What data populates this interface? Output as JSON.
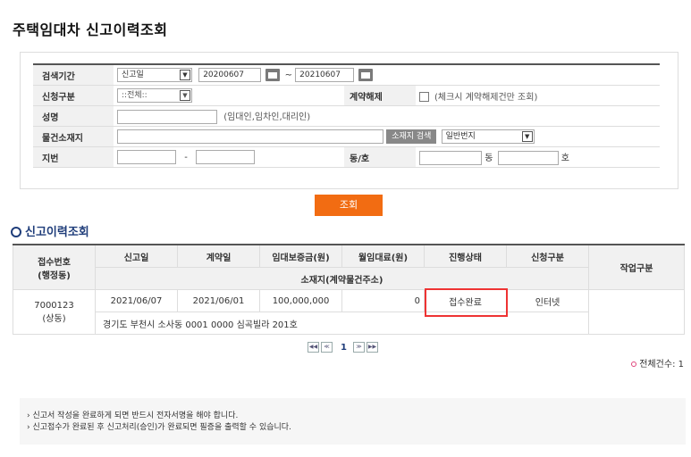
{
  "page_title": "주택임대차 신고이력조회",
  "search": {
    "period_label": "검색기간",
    "period_type": "신고일",
    "date_from": "20200607",
    "date_sep": "~",
    "date_to": "20210607",
    "apply_type_label": "신청구분",
    "apply_type_value": "::전체::",
    "contract_cancel_label": "계약해제",
    "contract_cancel_hint": "(체크시 계약해제건만 조회)",
    "name_label": "성명",
    "name_hint": "(임대인,임차인,대리인)",
    "location_label": "물건소재지",
    "location_search_button": "소재지 검색",
    "location_type": "일반번지",
    "lot_label": "지번",
    "lot_sep": "-",
    "dong_ho_label": "동/호",
    "dong_suffix": "동",
    "ho_suffix": "호",
    "submit_label": "조회"
  },
  "results": {
    "section_title": "신고이력조회",
    "headers": {
      "receipt_no": "접수번호",
      "receipt_sub": "(행정동)",
      "report_date": "신고일",
      "contract_date": "계약일",
      "deposit": "임대보증금(원)",
      "monthly_rent": "월임대료(원)",
      "progress": "진행상태",
      "apply_type": "신청구분",
      "address": "소재지(계약물건주소)",
      "action": "작업구분"
    },
    "rows": [
      {
        "receipt_no": "7000123",
        "admin_dong": "(상동)",
        "report_date": "2021/06/07",
        "contract_date": "2021/06/01",
        "deposit": "100,000,000",
        "monthly_rent": "0",
        "progress": "접수완료",
        "apply_type": "인터넷",
        "address": "경기도 부천시 소사동 0001 0000 심곡빌라 201호"
      }
    ],
    "pagination": {
      "current_page": "1"
    },
    "total_label": "전체건수: 1"
  },
  "notices": [
    "신고서 작성을 완료하게 되면 반드시 전자서명을 해야 합니다.",
    "신고접수가 완료된 후 신고처리(승인)가 완료되면 필증을 출력할 수 있습니다."
  ],
  "colors": {
    "accent": "#f26c12",
    "section_title": "#1f3d7a",
    "highlight": "#e33333"
  }
}
